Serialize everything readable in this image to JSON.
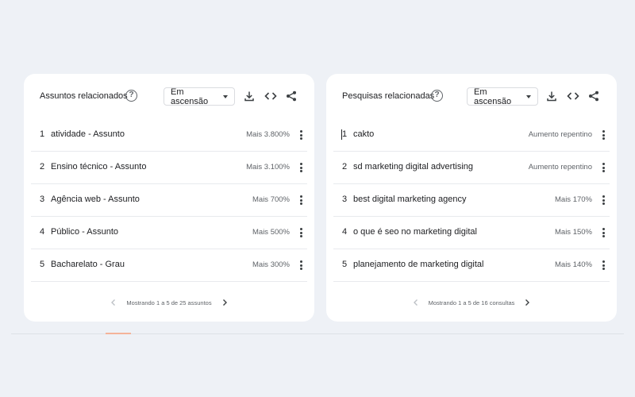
{
  "left_card": {
    "title": "Assuntos relacionados",
    "help_icon": "?",
    "dropdown_value": "Em ascensão",
    "rows": [
      {
        "rank": "1",
        "label": "atividade - Assunto",
        "value": "Mais 3.800%"
      },
      {
        "rank": "2",
        "label": "Ensino técnico - Assunto",
        "value": "Mais 3.100%"
      },
      {
        "rank": "3",
        "label": "Agência web - Assunto",
        "value": "Mais 700%"
      },
      {
        "rank": "4",
        "label": "Público - Assunto",
        "value": "Mais 500%"
      },
      {
        "rank": "5",
        "label": "Bacharelato - Grau",
        "value": "Mais 300%"
      }
    ],
    "pager_text": "Mostrando 1 a 5 de 25 assuntos"
  },
  "right_card": {
    "title": "Pesquisas relacionadas",
    "help_icon": "?",
    "dropdown_value": "Em ascensão",
    "rows": [
      {
        "rank": "1",
        "label": "cakto",
        "value": "Aumento repentino"
      },
      {
        "rank": "2",
        "label": "sd marketing digital advertising",
        "value": "Aumento repentino"
      },
      {
        "rank": "3",
        "label": "best digital marketing agency",
        "value": "Mais 170%"
      },
      {
        "rank": "4",
        "label": "o que é seo no marketing digital",
        "value": "Mais 150%"
      },
      {
        "rank": "5",
        "label": "planejamento de marketing digital",
        "value": "Mais 140%"
      }
    ],
    "pager_text": "Mostrando 1 a 5 de 16 consultas"
  },
  "icons": {
    "help": "question-circle-icon",
    "dropdown_caret": "caret-down-icon",
    "download": "download-icon",
    "embed": "code-embed-icon",
    "share": "share-icon",
    "row_menu": "more-vertical-icon",
    "pager_prev": "chevron-left-icon",
    "pager_next": "chevron-right-icon"
  },
  "colors": {
    "page_background": "#eef1f6",
    "card_background": "#ffffff",
    "text_primary": "#202124",
    "text_secondary": "#5f6368",
    "divider": "#e8eaed",
    "accent": "#f4b399"
  }
}
